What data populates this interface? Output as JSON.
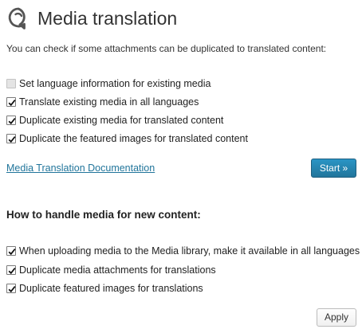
{
  "header": {
    "title": "Media translation",
    "logo_icon": "wpml-logo-icon"
  },
  "intro_text": "You can check if some attachments can be duplicated to translated content:",
  "existing_media_options": [
    {
      "label": "Set language information for existing media",
      "checked": false,
      "disabled": true
    },
    {
      "label": "Translate existing media in all languages",
      "checked": true,
      "disabled": false
    },
    {
      "label": "Duplicate existing media for translated content",
      "checked": true,
      "disabled": false
    },
    {
      "label": "Duplicate the featured images for translated content",
      "checked": true,
      "disabled": false
    }
  ],
  "documentation_link": "Media Translation Documentation",
  "start_button": "Start »",
  "new_content_section": {
    "title": "How to handle media for new content:",
    "options": [
      {
        "label": "When uploading media to the Media library, make it available in all languages",
        "checked": true
      },
      {
        "label": "Duplicate media attachments for translations",
        "checked": true
      },
      {
        "label": "Duplicate featured images for translations",
        "checked": true
      }
    ]
  },
  "apply_button": "Apply",
  "colors": {
    "link": "#21759b",
    "primary_button": "#21759b",
    "text": "#222222"
  }
}
